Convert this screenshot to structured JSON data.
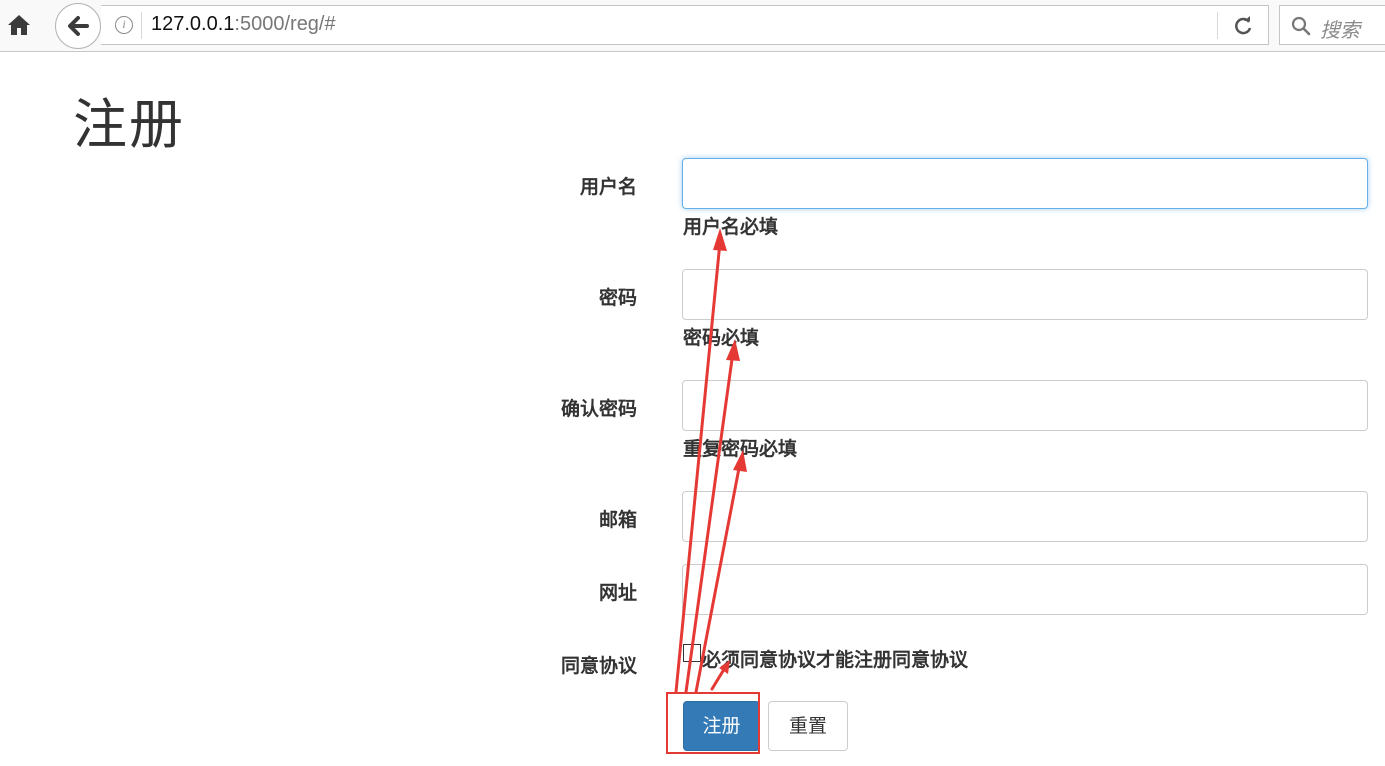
{
  "browser": {
    "url_host": "127.0.0.1",
    "url_path": ":5000/reg/#",
    "search_placeholder": "搜索"
  },
  "page": {
    "title": "注册"
  },
  "form": {
    "username": {
      "label": "用户名",
      "value": "",
      "help": "用户名必填"
    },
    "password": {
      "label": "密码",
      "value": "",
      "help": "密码必填"
    },
    "confirm": {
      "label": "确认密码",
      "value": "",
      "help": "重复密码必填"
    },
    "email": {
      "label": "邮箱",
      "value": ""
    },
    "website": {
      "label": "网址",
      "value": ""
    },
    "agree": {
      "label": "同意协议",
      "checked": false,
      "text": "必须同意协议才能注册同意协议"
    },
    "submit_label": "注册",
    "reset_label": "重置"
  },
  "colors": {
    "primary": "#337ab7",
    "annotation": "#e53935",
    "focus": "#66afe9"
  }
}
